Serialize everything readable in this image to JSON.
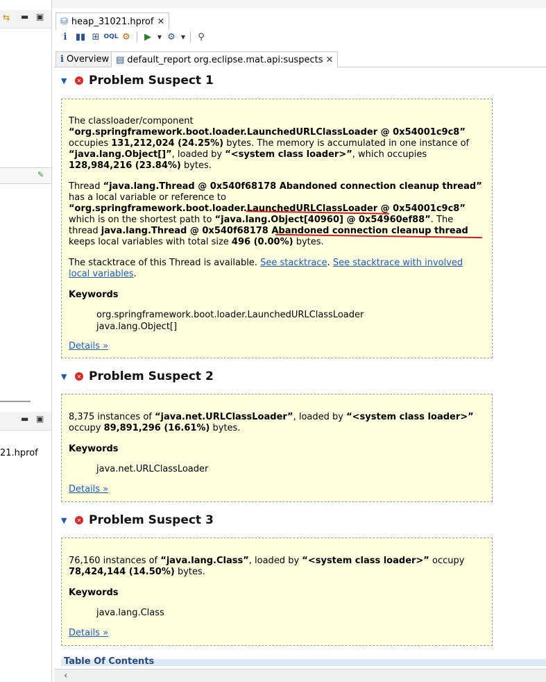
{
  "editor": {
    "file_tab": "heap_31021.hprof",
    "inner_tabs": [
      {
        "label": "Overview"
      },
      {
        "label": "default_report org.eclipse.mat.api:suspects"
      }
    ]
  },
  "left_pane": {
    "file_label": "21.hprof"
  },
  "suspects": [
    {
      "title": "Problem Suspect 1",
      "p1": {
        "a": "The classloader/component",
        "b": "“org.springframework.boot.loader.LaunchedURLClassLoader @ 0x54001c9c8”",
        "c": "occupies",
        "d": "131,212,024 (24.25%)",
        "e": "bytes. The memory is accumulated in one instance of",
        "f": "“java.lang.Object[]”",
        "g": ", loaded by",
        "h": "“<system class loader>”",
        "i": ", which occupies",
        "j": "128,984,216 (23.84%)",
        "k": "bytes."
      },
      "p2": {
        "a": "Thread",
        "b": "“java.lang.Thread @ 0x540f68178 Abandoned connection cleanup thread”",
        "c": "has a local variable or reference to",
        "d": "“org.springframework.boot.loader.LaunchedURLClassLoader @ 0x54001c9c8”",
        "e": "which is on the shortest path to",
        "f": "“java.lang.Object[40960] @ 0x54960ef88”",
        "g": ". The thread",
        "h": "java.lang.Thread @ 0x540f68178 Abandoned connection cleanup thread",
        "i": "keeps local variables with total size",
        "j": "496 (0.00%)",
        "k": "bytes."
      },
      "p3": {
        "a": "The stacktrace of this Thread is available.",
        "link1": "See stacktrace",
        "dot1": ".",
        "link2": "See stacktrace with involved local variables",
        "dot2": "."
      },
      "keywords_title": "Keywords",
      "keywords": [
        "org.springframework.boot.loader.LaunchedURLClassLoader",
        "java.lang.Object[]"
      ],
      "details": "Details »"
    },
    {
      "title": "Problem Suspect 2",
      "p1": {
        "a": "8,375 instances of",
        "b": "“java.net.URLClassLoader”",
        "c": ", loaded by",
        "d": "“<system class loader>”",
        "e": "occupy",
        "f": "89,891,296 (16.61%)",
        "g": "bytes."
      },
      "keywords_title": "Keywords",
      "keywords": [
        "java.net.URLClassLoader"
      ],
      "details": "Details »"
    },
    {
      "title": "Problem Suspect 3",
      "p1": {
        "a": "76,160 instances of",
        "b": "“java.lang.Class”",
        "c": ", loaded by",
        "d": "“<system class loader>”",
        "e": "occupy",
        "f": "78,424,144 (14.50%)",
        "g": "bytes."
      },
      "keywords_title": "Keywords",
      "keywords": [
        "java.lang.Class"
      ],
      "details": "Details »"
    }
  ],
  "toc_label": "Table Of Contents"
}
